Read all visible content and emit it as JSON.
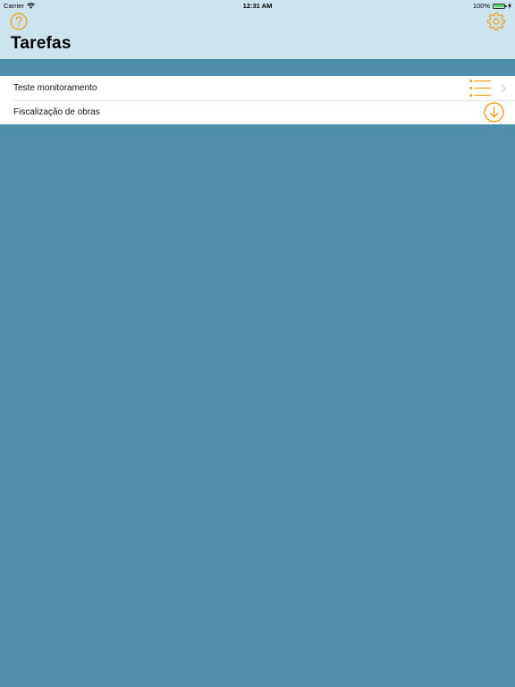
{
  "status_bar": {
    "carrier": "Carrier",
    "time": "12:31 AM",
    "battery": "100%"
  },
  "nav": {
    "title": "Tarefas",
    "help_icon": "question-circle-icon",
    "settings_icon": "gear-icon"
  },
  "tasks": [
    {
      "label": "Teste monitoramento",
      "icon": "list-icon",
      "accessory": "chevron-right-icon"
    },
    {
      "label": "Fiscalização de obras",
      "icon": "download-circle-icon"
    }
  ],
  "colors": {
    "accent": "#f0a020",
    "nav_background": "#cde4ee",
    "page_background": "#4f8fab",
    "battery": "#4cd964"
  }
}
